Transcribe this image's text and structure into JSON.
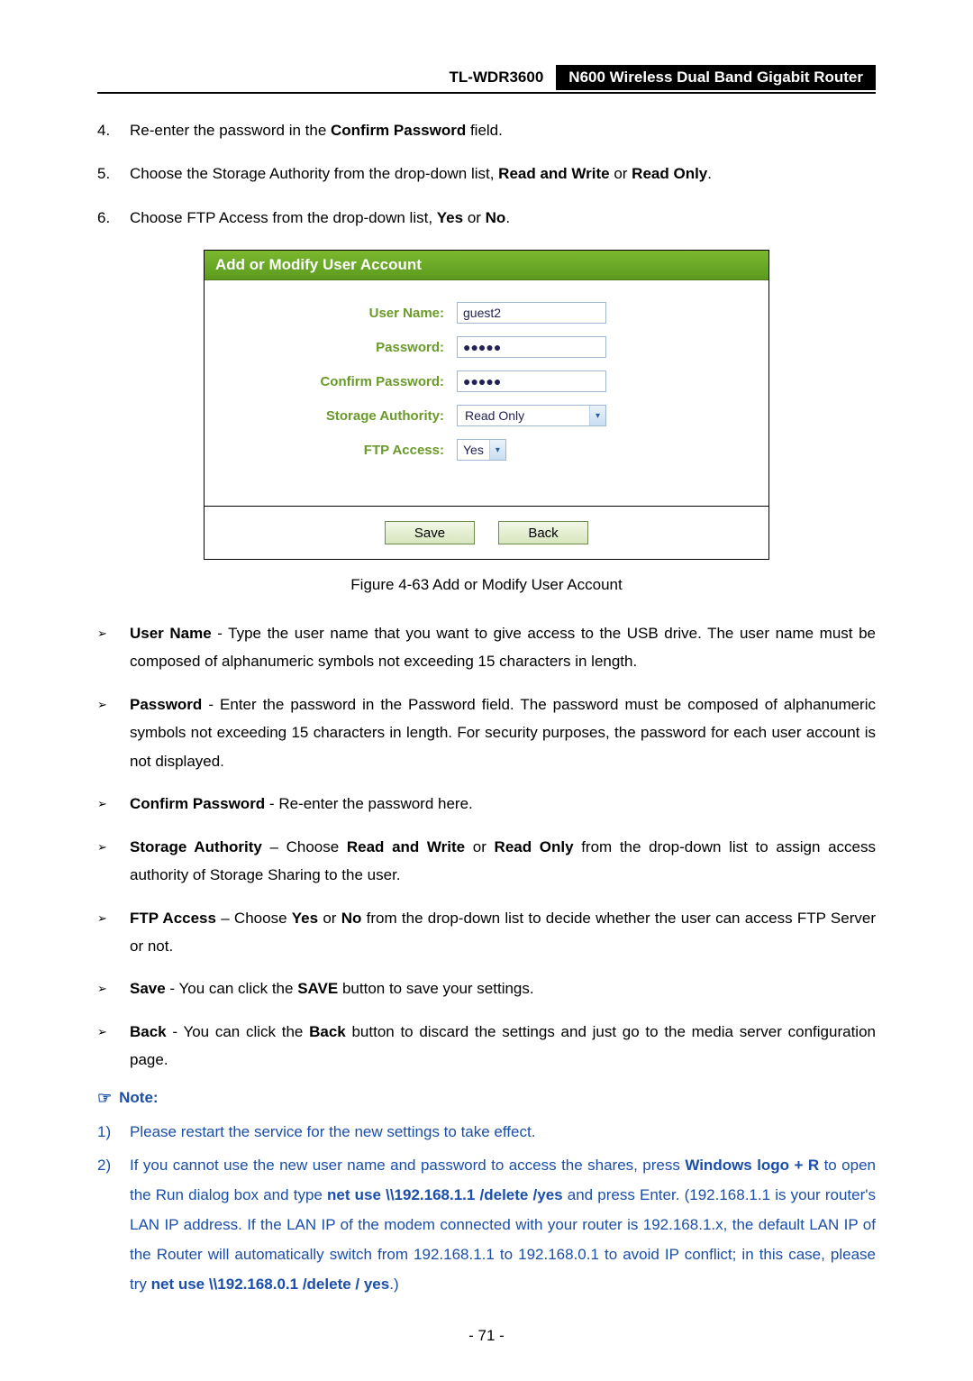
{
  "header": {
    "model": "TL-WDR3600",
    "title": "N600 Wireless Dual Band Gigabit Router"
  },
  "steps": [
    {
      "n": "4.",
      "pre": "Re-enter the password in the ",
      "bold1": "Confirm Password",
      "post1": " field."
    },
    {
      "n": "5.",
      "pre": "Choose the Storage Authority from the drop-down list, ",
      "bold1": "Read and Write",
      "mid": " or ",
      "bold2": "Read Only",
      "post2": "."
    },
    {
      "n": "6.",
      "pre": "Choose FTP Access from the drop-down list, ",
      "bold1": "Yes",
      "mid": " or ",
      "bold2": "No",
      "post2": "."
    }
  ],
  "figure": {
    "titlebar": "Add or Modify User Account",
    "rows": {
      "username_label": "User Name:",
      "username_value": "guest2",
      "password_label": "Password:",
      "password_value": "●●●●●",
      "confirm_label": "Confirm Password:",
      "confirm_value": "●●●●●",
      "storage_label": "Storage Authority:",
      "storage_selected": "Read Only",
      "ftp_label": "FTP Access:",
      "ftp_selected": "Yes"
    },
    "buttons": {
      "save": "Save",
      "back": "Back"
    },
    "caption": "Figure 4-63 Add or Modify User Account"
  },
  "bullets": [
    {
      "bold": "User Name",
      "sep": " - ",
      "rest": "Type the user name that you want to give access to the USB drive. The user name must be composed of alphanumeric symbols not exceeding 15 characters in length."
    },
    {
      "bold": "Password",
      "sep": " - ",
      "rest": "Enter the password in the Password field. The password must be composed of alphanumeric symbols not exceeding 15 characters in length. For security purposes, the password for each user account is not displayed."
    },
    {
      "bold": "Confirm Password",
      "sep": " - ",
      "rest": "Re-enter the password here."
    },
    {
      "bold": "Storage Authority",
      "sep": " – ",
      "rest_pre": "Choose ",
      "bold2": "Read and Write",
      "rest_mid": " or ",
      "bold3": "Read Only",
      "rest_post": " from the drop-down list to assign access authority of Storage Sharing to the user."
    },
    {
      "bold": "FTP Access",
      "sep": " – ",
      "rest_pre": "Choose ",
      "bold2": "Yes",
      "rest_mid": " or ",
      "bold3": "No",
      "rest_post": " from the drop-down list to decide whether the user can access FTP Server or not."
    },
    {
      "bold": "Save",
      "sep": " - ",
      "rest_pre": "You can click the ",
      "bold2": "SAVE",
      "rest_post": " button to save your settings."
    },
    {
      "bold": "Back",
      "sep": " - ",
      "rest_pre": "You can click the ",
      "bold2": "Back",
      "rest_post": " button to discard the settings and just go to the media server configuration page."
    }
  ],
  "note_header": "Note:",
  "notes": [
    {
      "n": "1)",
      "plain": "Please restart the service for the new settings to take effect."
    },
    {
      "n": "2)",
      "seg": [
        {
          "t": "If you cannot use the new user name and password to access the shares, press "
        },
        {
          "b": "Windows logo + R"
        },
        {
          "t": " to open the Run dialog box and type "
        },
        {
          "b": "net use \\\\192.168.1.1 /delete /yes"
        },
        {
          "t": " and press Enter. (192.168.1.1 is your router's LAN IP address. If the LAN IP of the modem connected with your router is 192.168.1.x, the default LAN IP of the Router will automatically switch from 192.168.1.1 to 192.168.0.1 to avoid IP conflict; in this case, please try "
        },
        {
          "b": "net use \\\\192.168.0.1 /delete / yes"
        },
        {
          "t": ".)"
        }
      ]
    }
  ],
  "pagenum": "- 71 -",
  "glyphs": {
    "arrow": "➢",
    "hand": "☞",
    "chevron": "▾"
  }
}
